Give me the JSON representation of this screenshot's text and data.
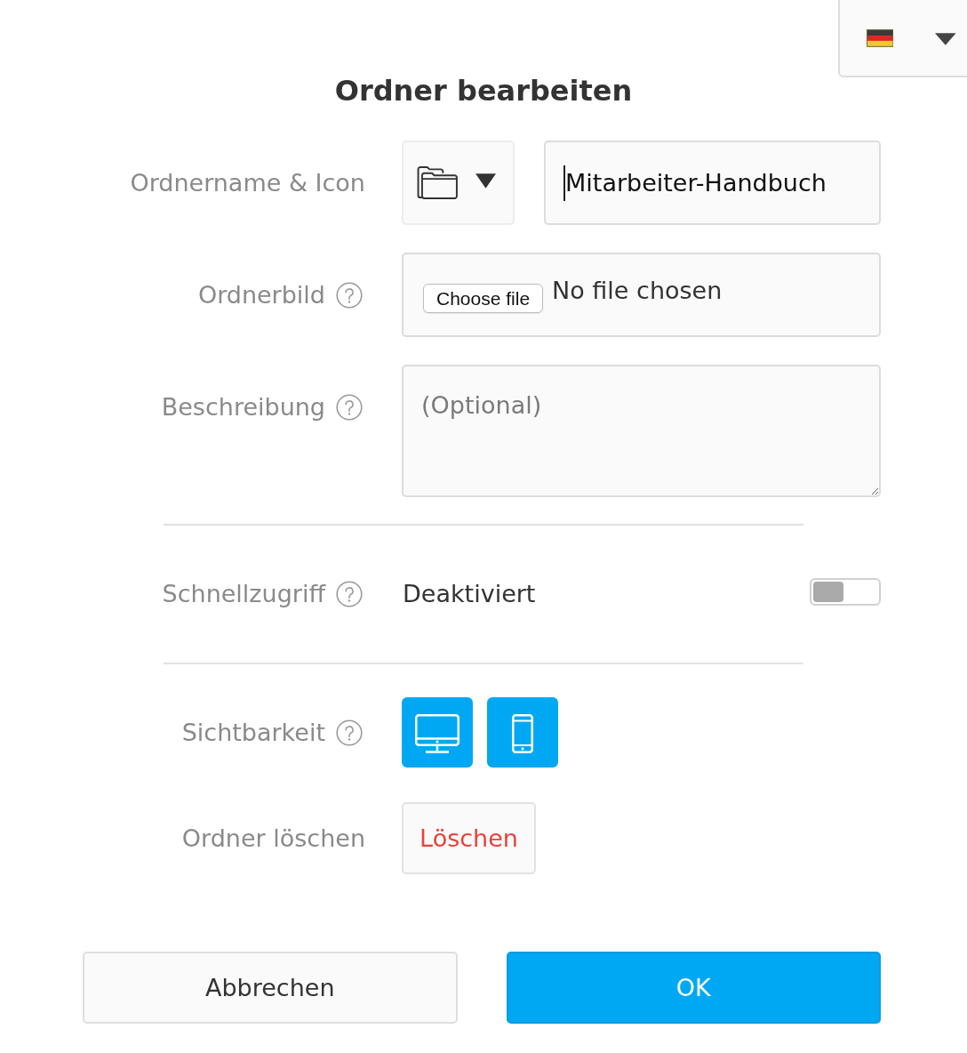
{
  "title": "Ordner bearbeiten",
  "sections": [
    {
      "rows": [
        {
          "kind": "icon_name",
          "label": "Ordnername & Icon",
          "help": false,
          "value": "Mitarbeiter-Handbuch",
          "focused": true
        },
        {
          "kind": "file",
          "label": "Ordnerbild",
          "help": true,
          "button": "Choose file",
          "status": "No file chosen"
        },
        {
          "kind": "textarea",
          "label": "Beschreibung",
          "help": true,
          "placeholder": "(Optional)"
        }
      ]
    },
    {
      "rows": [
        {
          "kind": "toggle",
          "label": "Schnellzugriff",
          "help": true,
          "status": "Deaktiviert",
          "on": false
        }
      ]
    },
    {
      "rows": [
        {
          "kind": "devices",
          "label": "Sichtbarkeit",
          "help": true,
          "options": [
            {
              "kind": "desktop",
              "selected": true
            },
            {
              "kind": "mobile",
              "selected": true
            }
          ]
        },
        {
          "kind": "delete",
          "label": "Ordner löschen",
          "help": false,
          "button": "Löschen"
        }
      ]
    }
  ],
  "buttons": [
    {
      "kind": "secondary",
      "label": "Abbrechen"
    },
    {
      "kind": "primary",
      "label": "OK"
    }
  ]
}
